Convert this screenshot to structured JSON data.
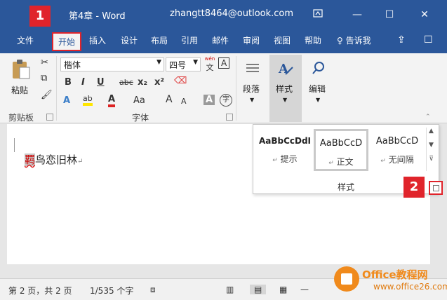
{
  "titlebar": {
    "title": "第4章 - Word",
    "account": "zhangtt8464@outlook.com",
    "ribbon_display_icon": "ribbon-display-icon",
    "minimize": "—",
    "maximize": "☐",
    "close": "✕"
  },
  "tabs": [
    "文件",
    "开始",
    "插入",
    "设计",
    "布局",
    "引用",
    "邮件",
    "审阅",
    "视图",
    "帮助"
  ],
  "active_tab": "开始",
  "tell_me": "告诉我",
  "badges": {
    "first": "1",
    "second": "2"
  },
  "clipboard": {
    "paste_label": "粘贴",
    "group_label": "剪贴板"
  },
  "font": {
    "font_name": "楷体",
    "font_size": "四号",
    "phonetic_top": "wén",
    "phonetic_char": "文",
    "border_char": "A",
    "bold": "B",
    "italic": "I",
    "underline": "U",
    "strike": "abc",
    "subscript": "x₂",
    "superscript": "x²",
    "text_effects": "A",
    "highlight": "ab",
    "font_color": "A",
    "change_case": "Aa",
    "grow": "A",
    "shrink": "A",
    "char_shading": "A",
    "enclose": "字",
    "group_label": "字体"
  },
  "paragraph": {
    "label": "段落"
  },
  "styles_button": {
    "label": "样式"
  },
  "editing": {
    "label": "编辑"
  },
  "styles_panel": {
    "items": [
      {
        "sample": "AaBbCcDdI",
        "name": "提示"
      },
      {
        "sample": "AaBbCcD",
        "name": "正文"
      },
      {
        "sample": "AaBbCcD",
        "name": "无间隔"
      }
    ],
    "selected_index": 1,
    "label": "样式"
  },
  "document": {
    "selected_char": "羁",
    "rest": "鸟恋旧林"
  },
  "statusbar": {
    "page": "第 2 页，共 2 页",
    "words": "1/535 个字"
  },
  "watermark": {
    "line1": "Office教程网",
    "line2": "www.office26.com"
  },
  "colors": {
    "title_bg": "#2b579a",
    "badge": "#e0242b",
    "watermark": "#f08a1c"
  }
}
